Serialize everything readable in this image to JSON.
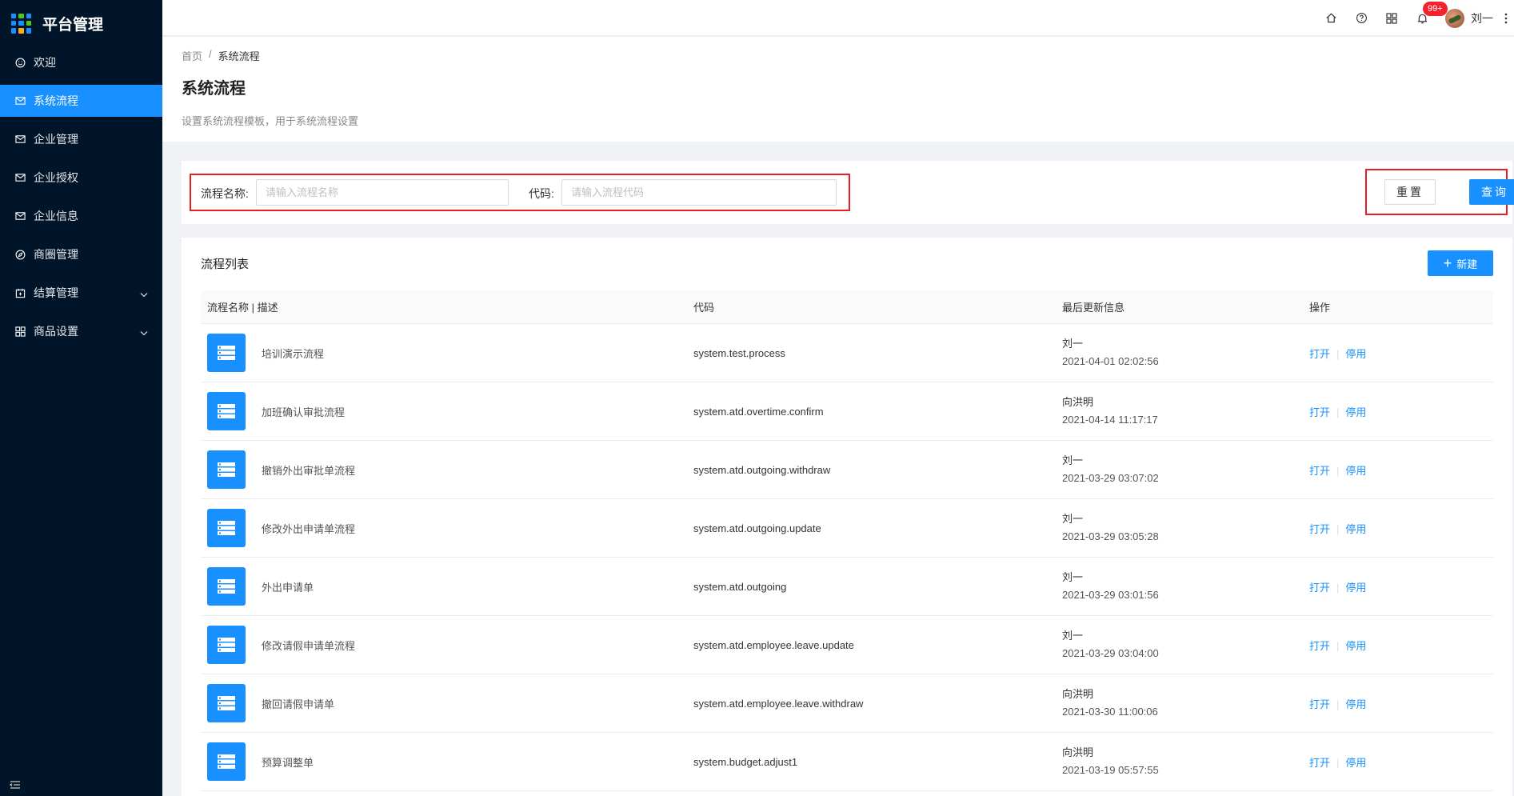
{
  "app": {
    "title": "平台管理"
  },
  "sidebar": {
    "items": [
      {
        "label": "欢迎",
        "icon": "smile-icon"
      },
      {
        "label": "系统流程",
        "icon": "mail-icon",
        "active": true
      },
      {
        "label": "企业管理",
        "icon": "mail-icon"
      },
      {
        "label": "企业授权",
        "icon": "mail-icon"
      },
      {
        "label": "企业信息",
        "icon": "mail-icon"
      },
      {
        "label": "商圈管理",
        "icon": "compass-icon"
      },
      {
        "label": "结算管理",
        "icon": "calendar-icon",
        "expandable": true
      },
      {
        "label": "商品设置",
        "icon": "appstore-icon",
        "expandable": true
      }
    ]
  },
  "header": {
    "notification_count": "99+",
    "user_name": "刘一"
  },
  "breadcrumb": {
    "home": "首页",
    "separator": "/",
    "current": "系统流程"
  },
  "page": {
    "title": "系统流程",
    "description": "设置系统流程模板，用于系统流程设置"
  },
  "search": {
    "name_label": "流程名称:",
    "name_placeholder": "请输入流程名称",
    "name_value": "",
    "code_label": "代码:",
    "code_placeholder": "请输入流程代码",
    "code_value": "",
    "reset_label": "重置",
    "query_label": "查询"
  },
  "list": {
    "title": "流程列表",
    "new_label": "新建",
    "columns": [
      "流程名称 | 描述",
      "代码",
      "最后更新信息",
      "操作"
    ],
    "action_open": "打开",
    "action_disable": "停用",
    "rows": [
      {
        "name": "培训演示流程",
        "code": "system.test.process",
        "user": "刘一",
        "time": "2021-04-01 02:02:56"
      },
      {
        "name": "加班确认审批流程",
        "code": "system.atd.overtime.confirm",
        "user": "向洪明",
        "time": "2021-04-14 11:17:17"
      },
      {
        "name": "撤销外出审批单流程",
        "code": "system.atd.outgoing.withdraw",
        "user": "刘一",
        "time": "2021-03-29 03:07:02"
      },
      {
        "name": "修改外出申请单流程",
        "code": "system.atd.outgoing.update",
        "user": "刘一",
        "time": "2021-03-29 03:05:28"
      },
      {
        "name": "外出申请单",
        "code": "system.atd.outgoing",
        "user": "刘一",
        "time": "2021-03-29 03:01:56"
      },
      {
        "name": "修改请假申请单流程",
        "code": "system.atd.employee.leave.update",
        "user": "刘一",
        "time": "2021-03-29 03:04:00"
      },
      {
        "name": "撤回请假申请单",
        "code": "system.atd.employee.leave.withdraw",
        "user": "向洪明",
        "time": "2021-03-30 11:00:06"
      },
      {
        "name": "预算调整单",
        "code": "system.budget.adjust1",
        "user": "向洪明",
        "time": "2021-03-19 05:57:55"
      }
    ]
  },
  "colors": {
    "primary": "#1890ff",
    "sidebar_bg": "#001529",
    "highlight": "#e52020",
    "badge": "#f5222d"
  }
}
